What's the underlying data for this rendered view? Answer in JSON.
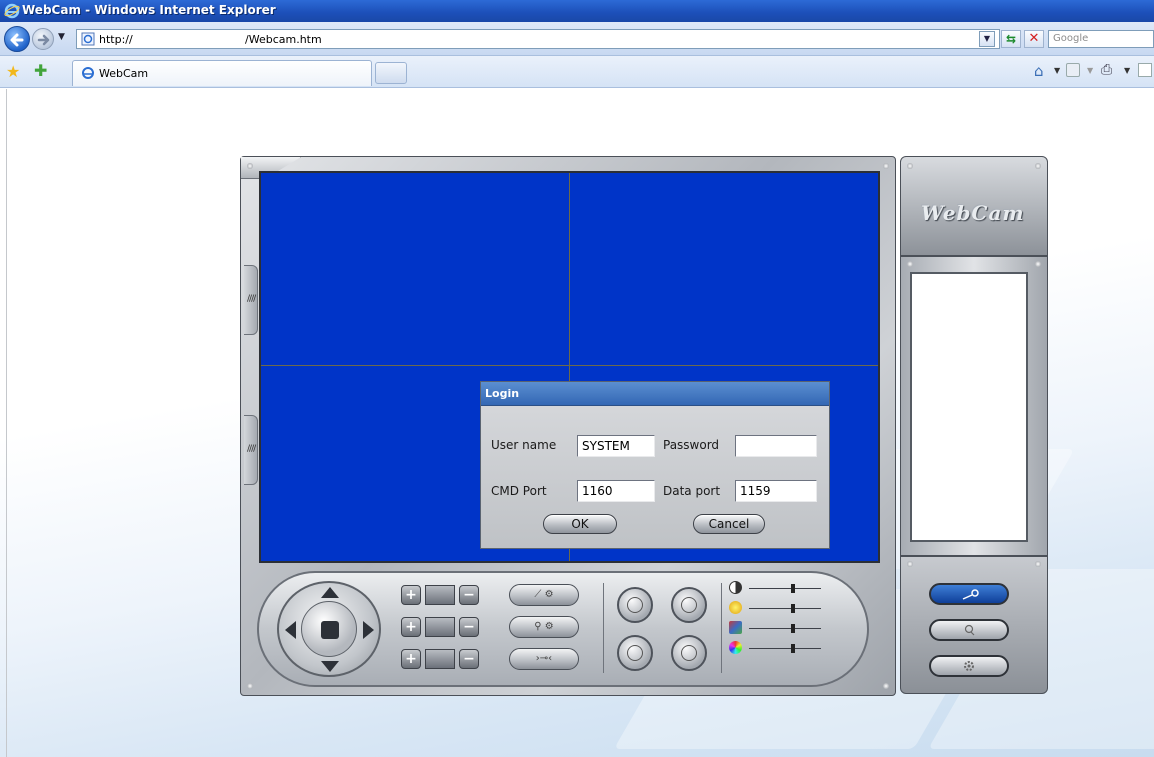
{
  "browser": {
    "window_title": "WebCam - Windows Internet Explorer",
    "url_part1": "http://",
    "url_part2": "/Webcam.htm",
    "search_placeholder": "Google",
    "tab_label": "WebCam"
  },
  "app": {
    "brand": "WebCam"
  },
  "login": {
    "title": "Login",
    "username_label": "User name",
    "username_value": "SYSTEM",
    "password_label": "Password",
    "password_value": "",
    "cmd_port_label": "CMD Port",
    "cmd_port_value": "1160",
    "data_port_label": "Data port",
    "data_port_value": "1159",
    "ok_label": "OK",
    "cancel_label": "Cancel"
  },
  "colors": {
    "video_bg": "#0034c8",
    "dialog_title": "#3a6fbe"
  },
  "icons": {
    "dpad": "pan-tilt-dpad-icon",
    "slider_1": "contrast-icon",
    "slider_2": "brightness-icon",
    "slider_3": "saturation-icon",
    "slider_4": "hue-icon"
  }
}
